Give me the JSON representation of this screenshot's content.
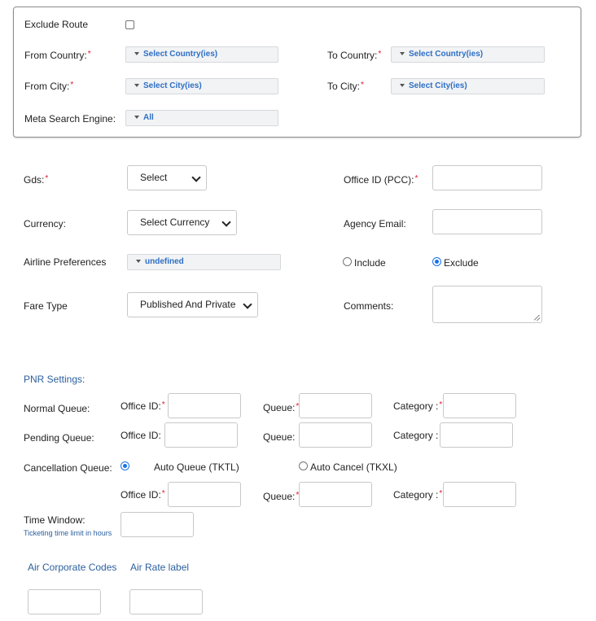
{
  "route": {
    "exclude_label": "Exclude Route",
    "from_country_label": "From Country:",
    "from_country_value": "Select Country(ies)",
    "to_country_label": "To Country:",
    "to_country_value": "Select Country(ies)",
    "from_city_label": "From City:",
    "from_city_value": "Select City(ies)",
    "to_city_label": "To City:",
    "to_city_value": "Select City(ies)",
    "meta_label": "Meta Search Engine:",
    "meta_value": "All",
    "required_mark": "*"
  },
  "form": {
    "gds_label": "Gds:",
    "gds_value": "Select",
    "office_id_label": "Office ID (PCC):",
    "currency_label": "Currency:",
    "currency_value": "Select Currency",
    "agency_email_label": "Agency Email:",
    "airline_pref_label": "Airline Preferences",
    "airline_pref_value": "undefined",
    "include_label": "Include",
    "exclude_label": "Exclude",
    "fare_type_label": "Fare Type",
    "fare_type_value": "Published And Private",
    "comments_label": "Comments:"
  },
  "pnr": {
    "title": "PNR Settings:",
    "normal_queue_label": "Normal Queue:",
    "pending_queue_label": "Pending Queue:",
    "cancellation_queue_label": "Cancellation Queue:",
    "office_id_label": "Office ID:",
    "queue_label": "Queue:",
    "category_label": "Category :",
    "auto_queue_label": "Auto Queue (TKTL)",
    "auto_cancel_label": "Auto Cancel (TKXL)",
    "time_window_label": "Time Window:",
    "time_window_hint": "Ticketing time limit in hours"
  },
  "codes": {
    "air_corporate_label": "Air Corporate Codes",
    "air_rate_label": "Air Rate label"
  },
  "colors": {
    "accent": "#2d6fc5",
    "required": "#e0162b",
    "section_title": "#2b5f9e"
  }
}
